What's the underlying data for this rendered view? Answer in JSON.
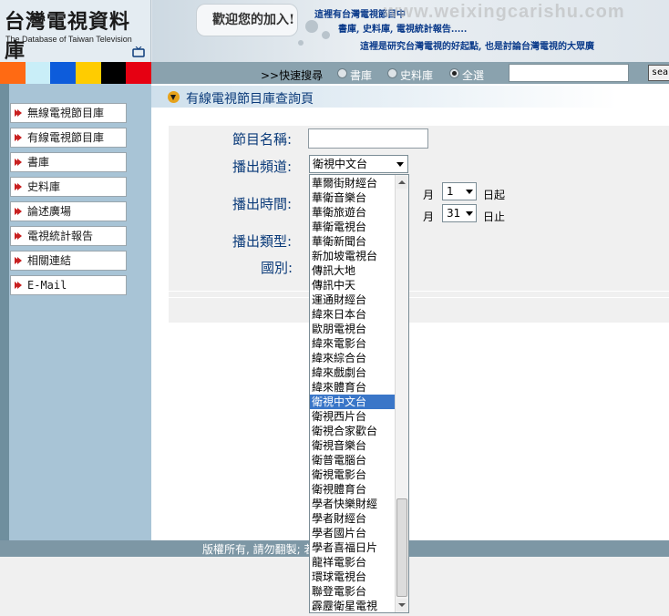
{
  "header": {
    "logo_title": "台灣電視資料庫",
    "logo_subtitle": "The Database of Taiwan Television",
    "welcome": "歡迎您的加入!",
    "banner_line1": "這裡有台灣電視節目中",
    "banner_line2": "書庫, 史料庫, 電視統計報告.....",
    "banner_line3": "這裡是研究台灣電視的好起點, 也是討論台灣電視的大眾廣",
    "watermark": "www.weixingcarishu.com"
  },
  "colors": {
    "strip": [
      "#ff6a13",
      "#c9eef8",
      "#0d5cdb",
      "#ffcc00",
      "#000000",
      "#e60012"
    ],
    "accent": "#0b3b7a",
    "sidebar_bg": "#a8c4d6",
    "selection": "#3a76c8"
  },
  "quicksearch": {
    "label": ">>快速搜尋",
    "options": [
      "書庫",
      "史料庫",
      "全選"
    ],
    "selected": "全選",
    "search_button": "sea"
  },
  "sidebar": {
    "items": [
      {
        "label": "無線電視節目庫",
        "icon": "double-arrow-icon"
      },
      {
        "label": "有線電視節目庫",
        "icon": "double-arrow-icon"
      },
      {
        "label": "書庫",
        "icon": "single-arrow-icon"
      },
      {
        "label": "史料庫",
        "icon": "single-arrow-icon"
      },
      {
        "label": "論述廣場",
        "icon": "single-arrow-icon"
      },
      {
        "label": "電視統計報告",
        "icon": "single-arrow-icon"
      },
      {
        "label": "相關連結",
        "icon": "single-arrow-icon"
      },
      {
        "label": "E-Mail",
        "icon": "single-arrow-icon"
      }
    ]
  },
  "main": {
    "title": "有線電視節目庫查詢頁",
    "form": {
      "program_name_label": "節目名稱:",
      "channel_label": "播出頻道:",
      "channel_value": "衛視中文台",
      "time_label": "播出時間:",
      "month_unit": "月",
      "start_day": "1",
      "start_suffix": "日起",
      "end_day": "31",
      "end_suffix": "日止",
      "type_label": "播出類型:",
      "country_label": "國別:"
    }
  },
  "dropdown": {
    "items": [
      "華爾街財經台",
      "華衛音樂台",
      "華衛旅遊台",
      "華衛電視台",
      "華衛新聞台",
      "新加坡電視台",
      "傳訊大地",
      "傳訊中天",
      "運通財經台",
      "緯來日本台",
      "歐朋電視台",
      "緯來電影台",
      "緯來綜合台",
      "緯來戲劇台",
      "緯來體育台",
      "衛視中文台",
      "衛視西片台",
      "衛視合家歡台",
      "衛視音樂台",
      "衛普電腦台",
      "衛視電影台",
      "衛視體育台",
      "學者快樂財經",
      "學者財經台",
      "學者國片台",
      "學者喜福日片",
      "龍祥電影台",
      "環球電視台",
      "聯登電影台",
      "霹靂衛星電視"
    ],
    "selected_index": 15
  },
  "footer": {
    "text": "版權所有, 請勿翻製; 若需引用, 請註明出處"
  }
}
